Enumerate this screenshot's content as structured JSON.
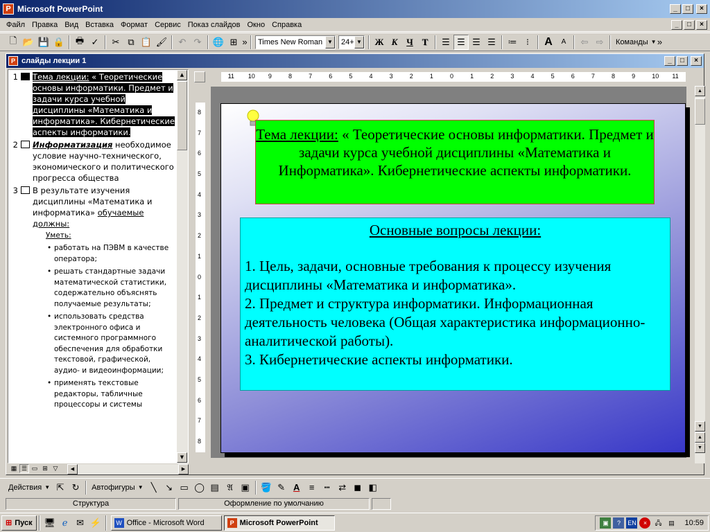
{
  "app": {
    "title": "Microsoft PowerPoint",
    "win_controls": [
      "_",
      "□",
      "×"
    ]
  },
  "menu": [
    "Файл",
    "Правка",
    "Вид",
    "Вставка",
    "Формат",
    "Сервис",
    "Показ слайдов",
    "Окно",
    "Справка"
  ],
  "toolbar": {
    "font_name": "Times New Roman",
    "font_size": "24+",
    "bold": "Ж",
    "italic": "К",
    "underline": "Ч",
    "shadow": "Т",
    "commands": "Команды"
  },
  "document": {
    "title": "слайды лекции 1"
  },
  "outline": {
    "slides": [
      {
        "num": "1",
        "lines": [
          "Тема лекции:",
          " « Теоретические основы информатики. Предмет и задачи курса учебной дисциплины «Математика и информатика». Кибернетические аспекты информатики."
        ]
      },
      {
        "num": "2",
        "head": "Информатизация",
        "rest": " необходимое условие научно-технического, экономического и политического прогресса общества"
      },
      {
        "num": "3",
        "head": "В результате изучения дисциплины «Математика и информатика» ",
        "underl": "обучаемые должны:",
        "sub": "Уметь:",
        "bullets": [
          "работать на ПЭВМ в качестве оператора;",
          "решать стандартные задачи математической статистики, содержательно объяснять получаемые результаты;",
          "использовать средства электронного офиса и системного программного обеспечения для обработки текстовой, графической, аудио- и видеоинформации;",
          "применять текстовые редакторы, табличные процессоры и системы"
        ]
      }
    ]
  },
  "slide": {
    "title_label": "Тема лекции:",
    "title_rest": " « Теоретические основы информатики. Предмет и задачи курса учебной дисциплины «Математика и Информатика». Кибернетические аспекты информатики.",
    "box_heading": "Основные вопросы лекции:",
    "items": [
      "1. Цель, задачи, основные требования к процессу изучения дисциплины «Математика и информатика».",
      "2. Предмет и структура информатики. Информационная деятельность человека (Общая характеристика информационно-аналитической работы).",
      "3. Кибернетические аспекты информатики."
    ],
    "box1_color": "#00ff00",
    "box2_color": "#00ffff"
  },
  "ruler_h": [
    "11",
    "10",
    "9",
    "8",
    "7",
    "6",
    "5",
    "4",
    "3",
    "2",
    "1",
    "0",
    "1",
    "2",
    "3",
    "4",
    "5",
    "6",
    "7",
    "8",
    "9",
    "10",
    "11"
  ],
  "ruler_v": [
    "8",
    "7",
    "6",
    "5",
    "4",
    "3",
    "2",
    "1",
    "0",
    "1",
    "2",
    "3",
    "4",
    "5",
    "6",
    "7",
    "8"
  ],
  "drawing": {
    "actions": "Действия",
    "autoshapes": "Автофигуры"
  },
  "status": {
    "view": "Структура",
    "design": "Оформление по умолчанию"
  },
  "taskbar": {
    "start": "Пуск",
    "tasks": [
      "Office - Microsoft Word",
      "Microsoft PowerPoint"
    ],
    "lang": "EN",
    "time": "10:59"
  }
}
